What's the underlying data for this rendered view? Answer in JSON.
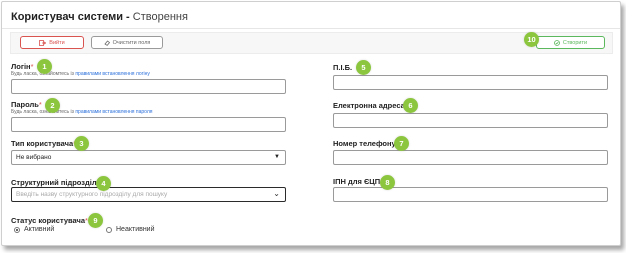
{
  "page": {
    "title_main": "Користувач системи",
    "title_sep": " - ",
    "title_sub": "Створення"
  },
  "toolbar": {
    "exit_label": "Вийти",
    "clear_label": "Очистити поля",
    "create_label": "Створити"
  },
  "form": {
    "login": {
      "label": "Логін",
      "required": "*",
      "hint_prefix": "Будь ласка, ознайомтесь із ",
      "hint_link": "правилами встановлення логіну",
      "value": ""
    },
    "password": {
      "label": "Пароль",
      "required": "*",
      "hint_prefix": "Будь ласка, ознайомтесь із ",
      "hint_link": "правилами встановлення пароля",
      "value": ""
    },
    "user_type": {
      "label": "Тип користувача",
      "required": "*",
      "selected": "Не вибрано"
    },
    "department": {
      "label": "Структурний підрозділ",
      "placeholder": "Введіть назву структурного підрозділу для пошуку"
    },
    "status": {
      "label": "Статус користувача",
      "required": "*",
      "options": [
        "Активний",
        "Неактивний"
      ],
      "selected": "Активний"
    },
    "full_name": {
      "label": "П.І.Б.",
      "value": ""
    },
    "email": {
      "label": "Електронна адреса",
      "value": ""
    },
    "phone": {
      "label": "Номер телефону",
      "value": ""
    },
    "ipn": {
      "label": "ІПН для ЄЦП",
      "value": ""
    }
  },
  "markers": [
    "1",
    "2",
    "3",
    "4",
    "5",
    "6",
    "7",
    "8",
    "9",
    "10"
  ],
  "colors": {
    "marker": "#8cc63f",
    "exit": "#d9534f",
    "create": "#5cb85c",
    "required": "#d9534f",
    "link": "#2a6fdb"
  },
  "icons": {
    "exit": "exit-icon",
    "clear": "eraser-icon",
    "create": "check-circle-icon"
  }
}
